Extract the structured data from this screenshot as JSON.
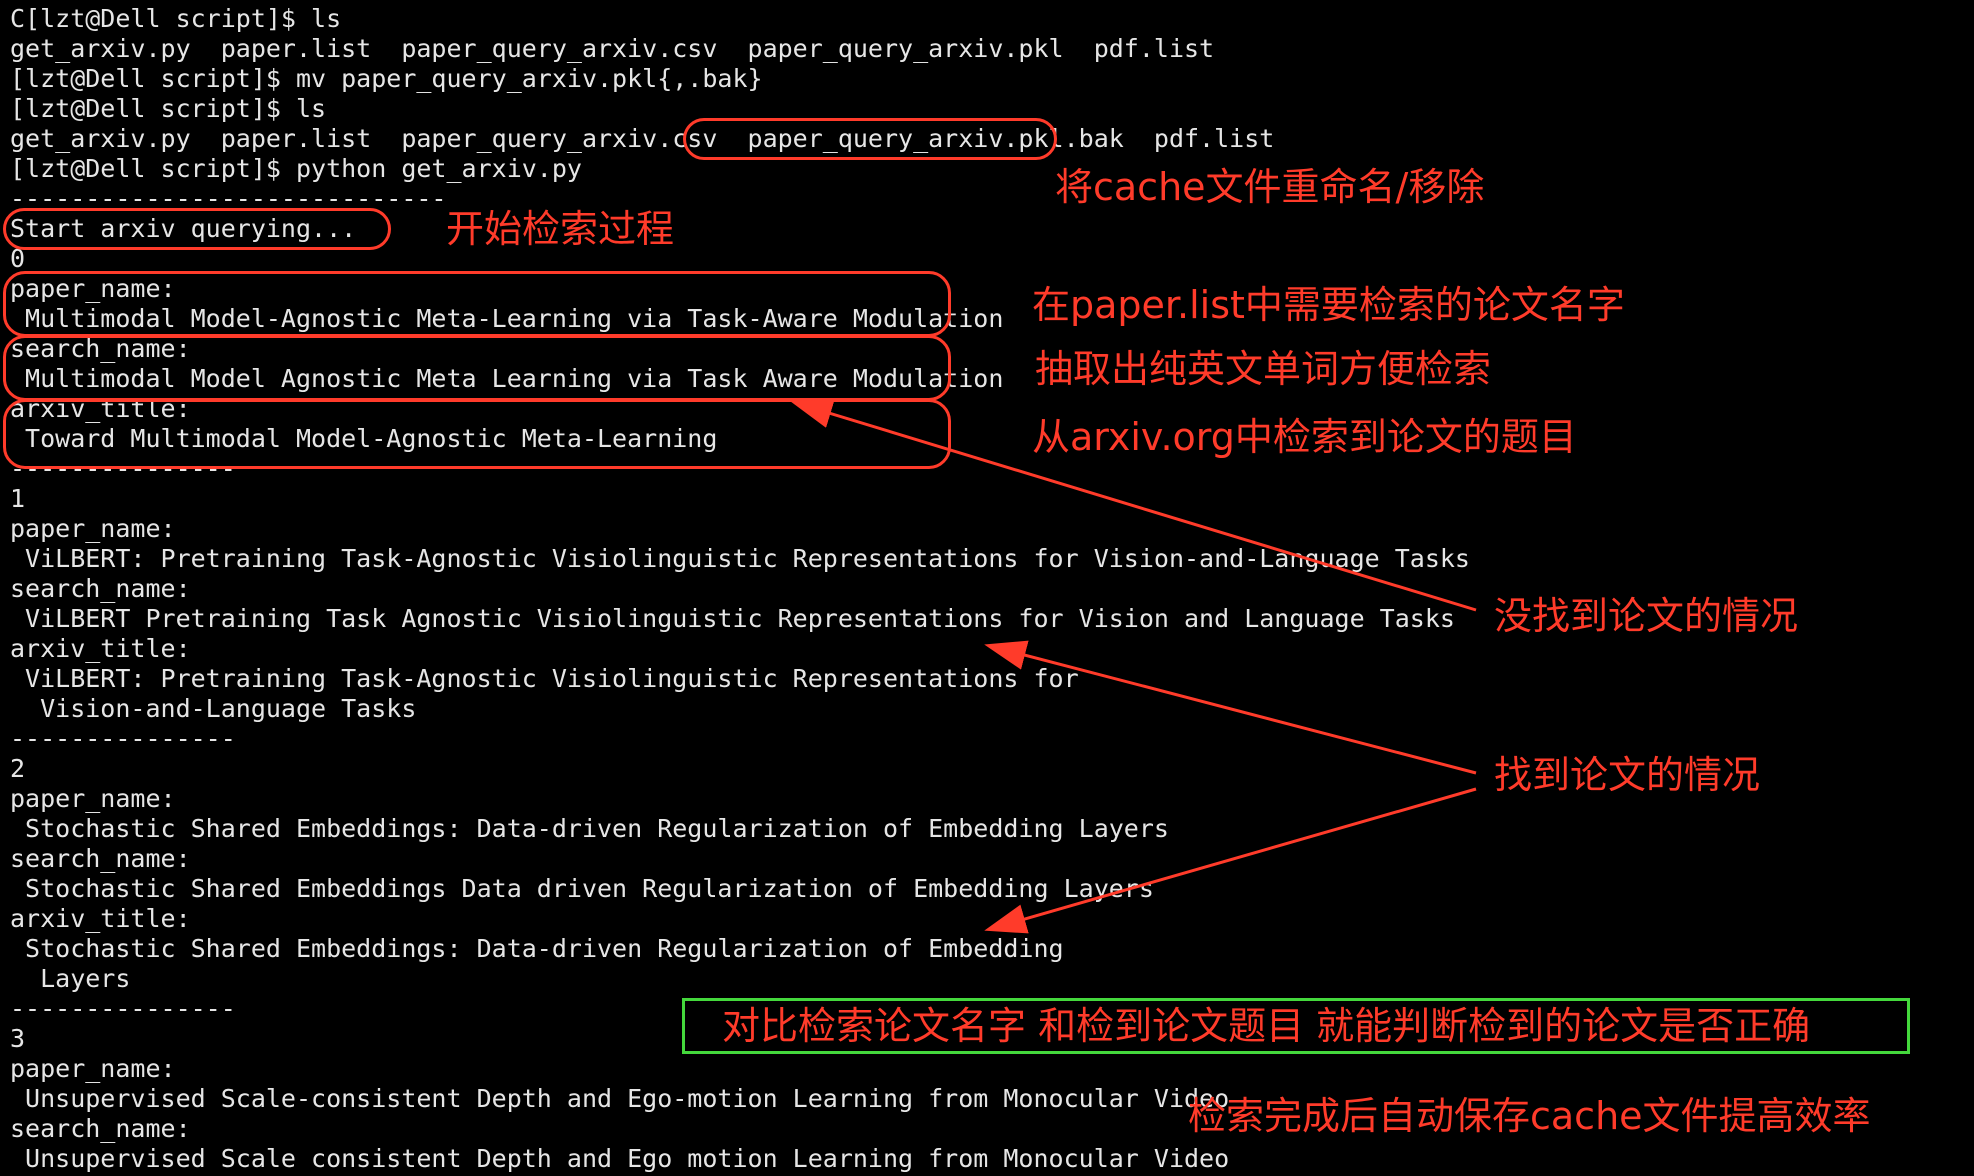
{
  "terminal_lines": [
    "C[lzt@Dell script]$ ls",
    "get_arxiv.py  paper.list  paper_query_arxiv.csv  paper_query_arxiv.pkl  pdf.list",
    "[lzt@Dell script]$ mv paper_query_arxiv.pkl{,.bak}",
    "[lzt@Dell script]$ ls",
    "get_arxiv.py  paper.list  paper_query_arxiv.csv  paper_query_arxiv.pkl.bak  pdf.list",
    "[lzt@Dell script]$ python get_arxiv.py",
    "-----------------------------",
    "Start arxiv querying...",
    "0",
    "paper_name:",
    " Multimodal Model-Agnostic Meta-Learning via Task-Aware Modulation",
    "search_name:",
    " Multimodal Model Agnostic Meta Learning via Task Aware Modulation",
    "arxiv_title:",
    " Toward Multimodal Model-Agnostic Meta-Learning",
    "---------------",
    "1",
    "paper_name:",
    " ViLBERT: Pretraining Task-Agnostic Visiolinguistic Representations for Vision-and-Language Tasks",
    "search_name:",
    " ViLBERT Pretraining Task Agnostic Visiolinguistic Representations for Vision and Language Tasks",
    "arxiv_title:",
    " ViLBERT: Pretraining Task-Agnostic Visiolinguistic Representations for",
    "  Vision-and-Language Tasks",
    "---------------",
    "2",
    "paper_name:",
    " Stochastic Shared Embeddings: Data-driven Regularization of Embedding Layers",
    "search_name:",
    " Stochastic Shared Embeddings Data driven Regularization of Embedding Layers",
    "arxiv_title:",
    " Stochastic Shared Embeddings: Data-driven Regularization of Embedding",
    "  Layers",
    "---------------",
    "3",
    "paper_name:",
    " Unsupervised Scale-consistent Depth and Ego-motion Learning from Monocular Video",
    "search_name:",
    " Unsupervised Scale consistent Depth and Ego motion Learning from Monocular Video"
  ],
  "annotations": {
    "rename_cache": "将cache文件重命名/移除",
    "start_search": "开始检索过程",
    "paper_list_name": "在paper.list中需要检索的论文名字",
    "extract_english": "抽取出纯英文单词方便检索",
    "arxiv_title": "从arxiv.org中检索到论文的题目",
    "not_found": "没找到论文的情况",
    "found": "找到论文的情况",
    "compare": "对比检索论文名字 和检到论文题目 就能判断检到的论文是否正确",
    "auto_save": "检索完成后自动保存cache文件提高效率"
  },
  "colors": {
    "annotation": "#ff3b2a",
    "highlight_box": "#44d83c",
    "terminal_text": "#e6e6e6",
    "background": "#000000"
  }
}
